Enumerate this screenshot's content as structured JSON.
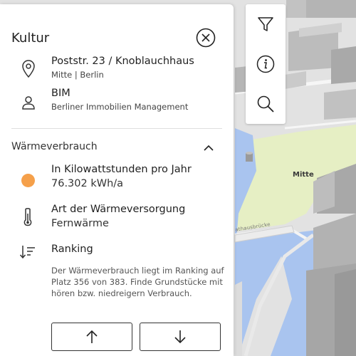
{
  "panel": {
    "title": "Kultur",
    "address": {
      "line1": "Poststr. 23 / Knoblauchhaus",
      "line2": "Mitte | Berlin"
    },
    "owner": {
      "line1": "BIM",
      "line2": "Berliner Immobilien Management"
    },
    "section": {
      "title": "Wärmeverbrauch",
      "consumption": {
        "label": "In Kilowattstunden pro Jahr",
        "value": "76.302 kWh/a",
        "color": "#f5a04a"
      },
      "supply": {
        "label": "Art der Wärmeversorgung",
        "value": "Fernwärme"
      },
      "ranking": {
        "label": "Ranking",
        "description": "Der Wärmeverbrauch liegt im Ranking auf Platz 356 von 383. Finde Grundstücke mit hören bzw. niedreigern Verbrauch."
      }
    }
  },
  "map": {
    "district_label": "Mitte",
    "bridge_label": "athausbrücke"
  },
  "toolbar": {
    "icons": [
      "filter-icon",
      "info-icon",
      "search-icon"
    ]
  }
}
